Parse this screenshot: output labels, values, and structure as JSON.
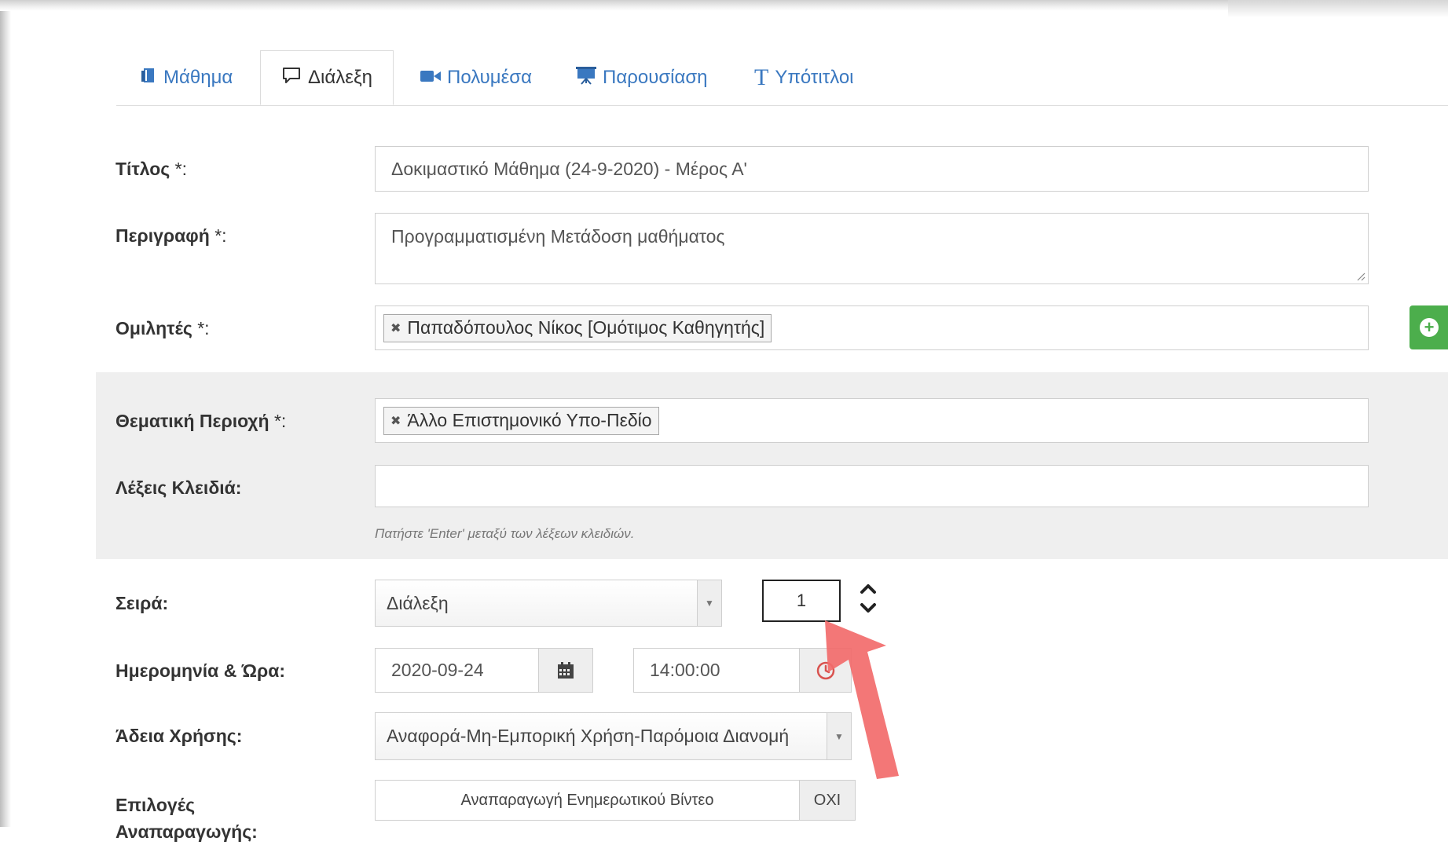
{
  "tabs": [
    {
      "label": "Μάθημα",
      "icon": "book-icon"
    },
    {
      "label": "Διάλεξη",
      "icon": "chat-bubble-icon"
    },
    {
      "label": "Πολυμέσα",
      "icon": "video-camera-icon"
    },
    {
      "label": "Παρουσίαση",
      "icon": "presentation-board-icon"
    },
    {
      "label": "Υπότιτλοι",
      "icon": "text-t-icon"
    }
  ],
  "form": {
    "title_label": "Τίτλος",
    "title_value": "Δοκιμαστικό Μάθημα (24-9-2020) - Μέρος Α'",
    "description_label": "Περιγραφή",
    "description_value": "Προγραμματισμένη Μετάδοση μαθήματος",
    "speakers_label": "Ομιλητές",
    "speaker_tag": "Παπαδόπουλος Νίκος [Ομότιμος Καθηγητής]",
    "topic_label": "Θεματική Περιοχή",
    "topic_tag": "Άλλο Επιστημονικό Υπο-Πεδίο",
    "keywords_label": "Λέξεις Κλειδιά:",
    "keywords_hint": "Πατήστε 'Enter' μεταξύ των λέξεων κλειδιών.",
    "series_label": "Σειρά:",
    "series_value": "Διάλεξη",
    "series_number": "1",
    "datetime_label": "Ημερομηνία & Ώρα:",
    "date_value": "2020-09-24",
    "time_value": "14:00:00",
    "license_label": "Άδεια Χρήσης:",
    "license_value": "Αναφορά-Μη-Εμπορική Χρήση-Παρόμοια Διανομή",
    "options_label": "Επιλογές Αναπαραγωγής:",
    "playback_option": "Αναπαραγωγή Ενημερωτικού Βίντεο",
    "playback_toggle": "ΟΧΙ",
    "required_suffix": "*:"
  },
  "colors": {
    "link_blue": "#3a78c0",
    "green_button": "#4cae4c",
    "gray_band": "#efefef",
    "arrow_red": "#f26b6b",
    "clock_red": "#d9534f"
  }
}
